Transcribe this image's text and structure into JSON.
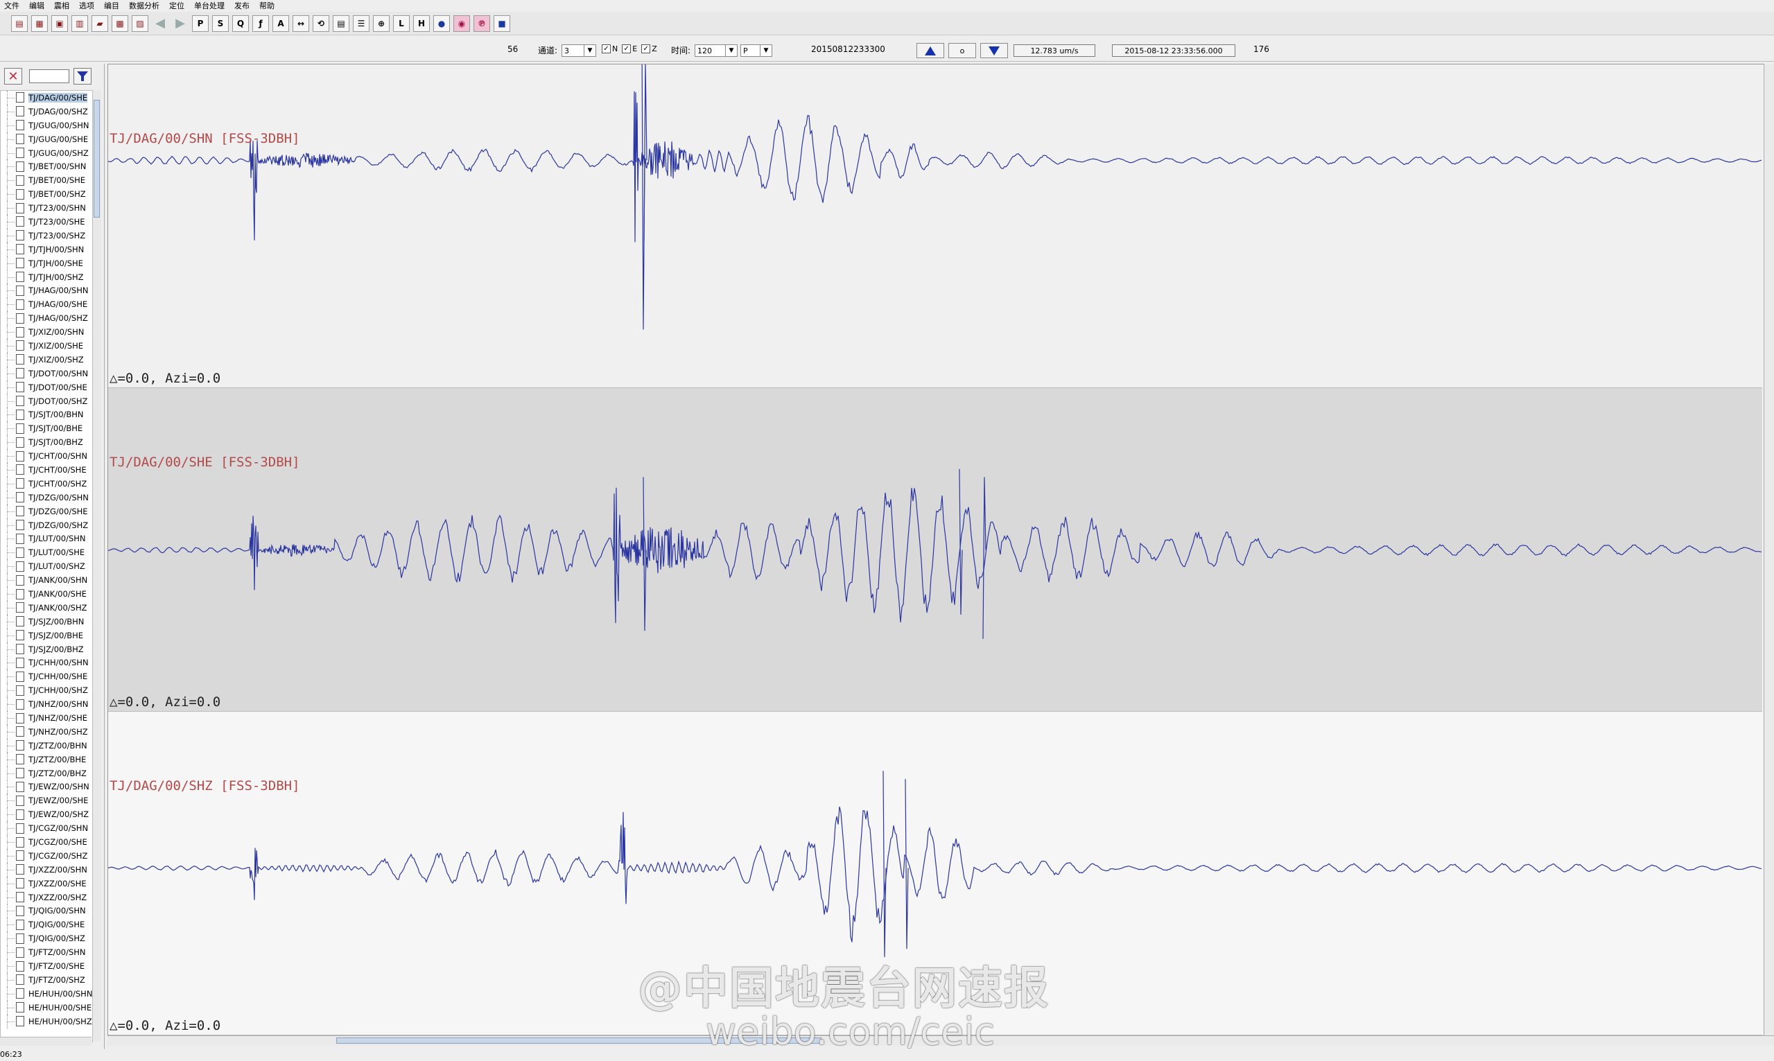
{
  "menu": [
    "文件",
    "编辑",
    "震相",
    "选项",
    "编目",
    "数据分析",
    "定位",
    "单台处理",
    "发布",
    "帮助"
  ],
  "toolbar": {
    "icons": [
      "chart-icon",
      "calculator-icon",
      "open-icon",
      "export-icon",
      "folder-icon",
      "save-icon",
      "print-icon",
      "back-arrow-icon",
      "forward-arrow-icon",
      "pick-p-icon",
      "pick-s-icon",
      "zoom-icon",
      "filter-icon",
      "amplitude-icon",
      "measure-icon",
      "rotate-icon",
      "print-trace-icon",
      "list-icon",
      "magnify-icon",
      "l-phase-icon",
      "h-phase-icon",
      "station-icon",
      "spectrum-icon",
      "p-phase-icon",
      "book-icon"
    ]
  },
  "controls": {
    "count": "56",
    "channel_label": "通道:",
    "channel_value": "3",
    "checks": [
      {
        "label": "N",
        "checked": true
      },
      {
        "label": "E",
        "checked": true
      },
      {
        "label": "Z",
        "checked": true
      }
    ],
    "time_label": "时间:",
    "time_value": "120",
    "phase_value": "P",
    "event_id": "20150812233300",
    "zero_label": "o",
    "amplitude": "12.783 um/s",
    "datetime": "2015-08-12 23:33:56.000",
    "total": "176"
  },
  "tree": {
    "selected_index": 0,
    "items": [
      "TJ/DAG/00/SHE",
      "TJ/DAG/00/SHZ",
      "TJ/GUG/00/SHN",
      "TJ/GUG/00/SHE",
      "TJ/GUG/00/SHZ",
      "TJ/BET/00/SHN",
      "TJ/BET/00/SHE",
      "TJ/BET/00/SHZ",
      "TJ/T23/00/SHN",
      "TJ/T23/00/SHE",
      "TJ/T23/00/SHZ",
      "TJ/TJH/00/SHN",
      "TJ/TJH/00/SHE",
      "TJ/TJH/00/SHZ",
      "TJ/HAG/00/SHN",
      "TJ/HAG/00/SHE",
      "TJ/HAG/00/SHZ",
      "TJ/XIZ/00/SHN",
      "TJ/XIZ/00/SHE",
      "TJ/XIZ/00/SHZ",
      "TJ/DOT/00/SHN",
      "TJ/DOT/00/SHE",
      "TJ/DOT/00/SHZ",
      "TJ/SJT/00/BHN",
      "TJ/SJT/00/BHE",
      "TJ/SJT/00/BHZ",
      "TJ/CHT/00/SHN",
      "TJ/CHT/00/SHE",
      "TJ/CHT/00/SHZ",
      "TJ/DZG/00/SHN",
      "TJ/DZG/00/SHE",
      "TJ/DZG/00/SHZ",
      "TJ/LUT/00/SHN",
      "TJ/LUT/00/SHE",
      "TJ/LUT/00/SHZ",
      "TJ/ANK/00/SHN",
      "TJ/ANK/00/SHE",
      "TJ/ANK/00/SHZ",
      "TJ/SJZ/00/BHN",
      "TJ/SJZ/00/BHE",
      "TJ/SJZ/00/BHZ",
      "TJ/CHH/00/SHN",
      "TJ/CHH/00/SHE",
      "TJ/CHH/00/SHZ",
      "TJ/NHZ/00/SHN",
      "TJ/NHZ/00/SHE",
      "TJ/NHZ/00/SHZ",
      "TJ/ZTZ/00/BHN",
      "TJ/ZTZ/00/BHE",
      "TJ/ZTZ/00/BHZ",
      "TJ/EWZ/00/SHN",
      "TJ/EWZ/00/SHE",
      "TJ/EWZ/00/SHZ",
      "TJ/CGZ/00/SHN",
      "TJ/CGZ/00/SHE",
      "TJ/CGZ/00/SHZ",
      "TJ/XZZ/00/SHN",
      "TJ/XZZ/00/SHE",
      "TJ/XZZ/00/SHZ",
      "TJ/QIG/00/SHN",
      "TJ/QIG/00/SHE",
      "TJ/QIG/00/SHZ",
      "TJ/FTZ/00/SHN",
      "TJ/FTZ/00/SHE",
      "TJ/FTZ/00/SHZ",
      "HE/HUH/00/SHN",
      "HE/HUH/00/SHE",
      "HE/HUH/00/SHZ"
    ]
  },
  "traces": [
    {
      "title": "TJ/DAG/00/SHN [FSS-3DBH]",
      "info": "△=0.0, Azi=0.0",
      "bg": "#f0f0f0",
      "segments": [
        [
          0,
          205,
          0.05,
          20,
          1
        ],
        [
          205,
          12,
          0.9,
          4,
          2
        ],
        [
          217,
          140,
          0.08,
          8,
          3
        ],
        [
          357,
          400,
          0.14,
          45,
          4
        ],
        [
          757,
          8,
          1.0,
          3,
          5
        ],
        [
          765,
          80,
          0.22,
          5,
          6
        ],
        [
          845,
          60,
          0.15,
          14,
          7
        ],
        [
          905,
          210,
          0.55,
          42,
          8
        ],
        [
          1115,
          70,
          0.22,
          35,
          9
        ],
        [
          1185,
          200,
          0.1,
          40,
          10
        ],
        [
          1385,
          1001,
          0.05,
          36,
          11
        ]
      ],
      "spikes": [
        [
          770,
          -1.3,
          1.9
        ],
        [
          773,
          0.9,
          -1.1
        ]
      ],
      "color": "#2a35a0"
    },
    {
      "title": "TJ/DAG/00/SHE [FSS-3DBH]",
      "info": "△=0.0, Azi=0.0",
      "bg": "#d9d9d9",
      "segments": [
        [
          0,
          205,
          0.04,
          20,
          21
        ],
        [
          205,
          12,
          0.5,
          4,
          22
        ],
        [
          217,
          110,
          0.08,
          8,
          23
        ],
        [
          327,
          400,
          0.45,
          40,
          24
        ],
        [
          727,
          12,
          0.95,
          3,
          25
        ],
        [
          739,
          120,
          0.3,
          6,
          26
        ],
        [
          859,
          140,
          0.42,
          40,
          27
        ],
        [
          999,
          290,
          0.92,
          38,
          28
        ],
        [
          1289,
          200,
          0.45,
          42,
          29
        ],
        [
          1489,
          200,
          0.25,
          42,
          30
        ],
        [
          1689,
          697,
          0.08,
          40,
          31
        ]
      ],
      "spikes": [
        [
          1262,
          1.1,
          -0.9
        ],
        [
          1228,
          -1.0,
          0.8
        ],
        [
          772,
          -0.9,
          1.0
        ]
      ],
      "color": "#2a35a0"
    },
    {
      "title": "TJ/DAG/00/SHZ [FSS-3DBH]",
      "info": "△=0.0, Azi=0.0",
      "bg": "#f6f6f6",
      "segments": [
        [
          0,
          205,
          0.03,
          20,
          41
        ],
        [
          205,
          12,
          0.4,
          4,
          42
        ],
        [
          217,
          150,
          0.05,
          10,
          43
        ],
        [
          367,
          370,
          0.24,
          40,
          44
        ],
        [
          737,
          12,
          0.85,
          3,
          45
        ],
        [
          749,
          140,
          0.08,
          10,
          46
        ],
        [
          889,
          120,
          0.3,
          40,
          47
        ],
        [
          1009,
          140,
          1.0,
          40,
          48
        ],
        [
          1149,
          100,
          0.55,
          38,
          49
        ],
        [
          1249,
          200,
          0.1,
          36,
          50
        ],
        [
          1449,
          937,
          0.06,
          36,
          51
        ]
      ],
      "spikes": [
        [
          1118,
          -1.2,
          1.1
        ],
        [
          1150,
          -1.1,
          1.0
        ]
      ],
      "color": "#2a35a0"
    }
  ],
  "status": "06:23",
  "watermark": {
    "line1": "@中国地震台网速报",
    "line2": "weibo.com/ceic"
  }
}
